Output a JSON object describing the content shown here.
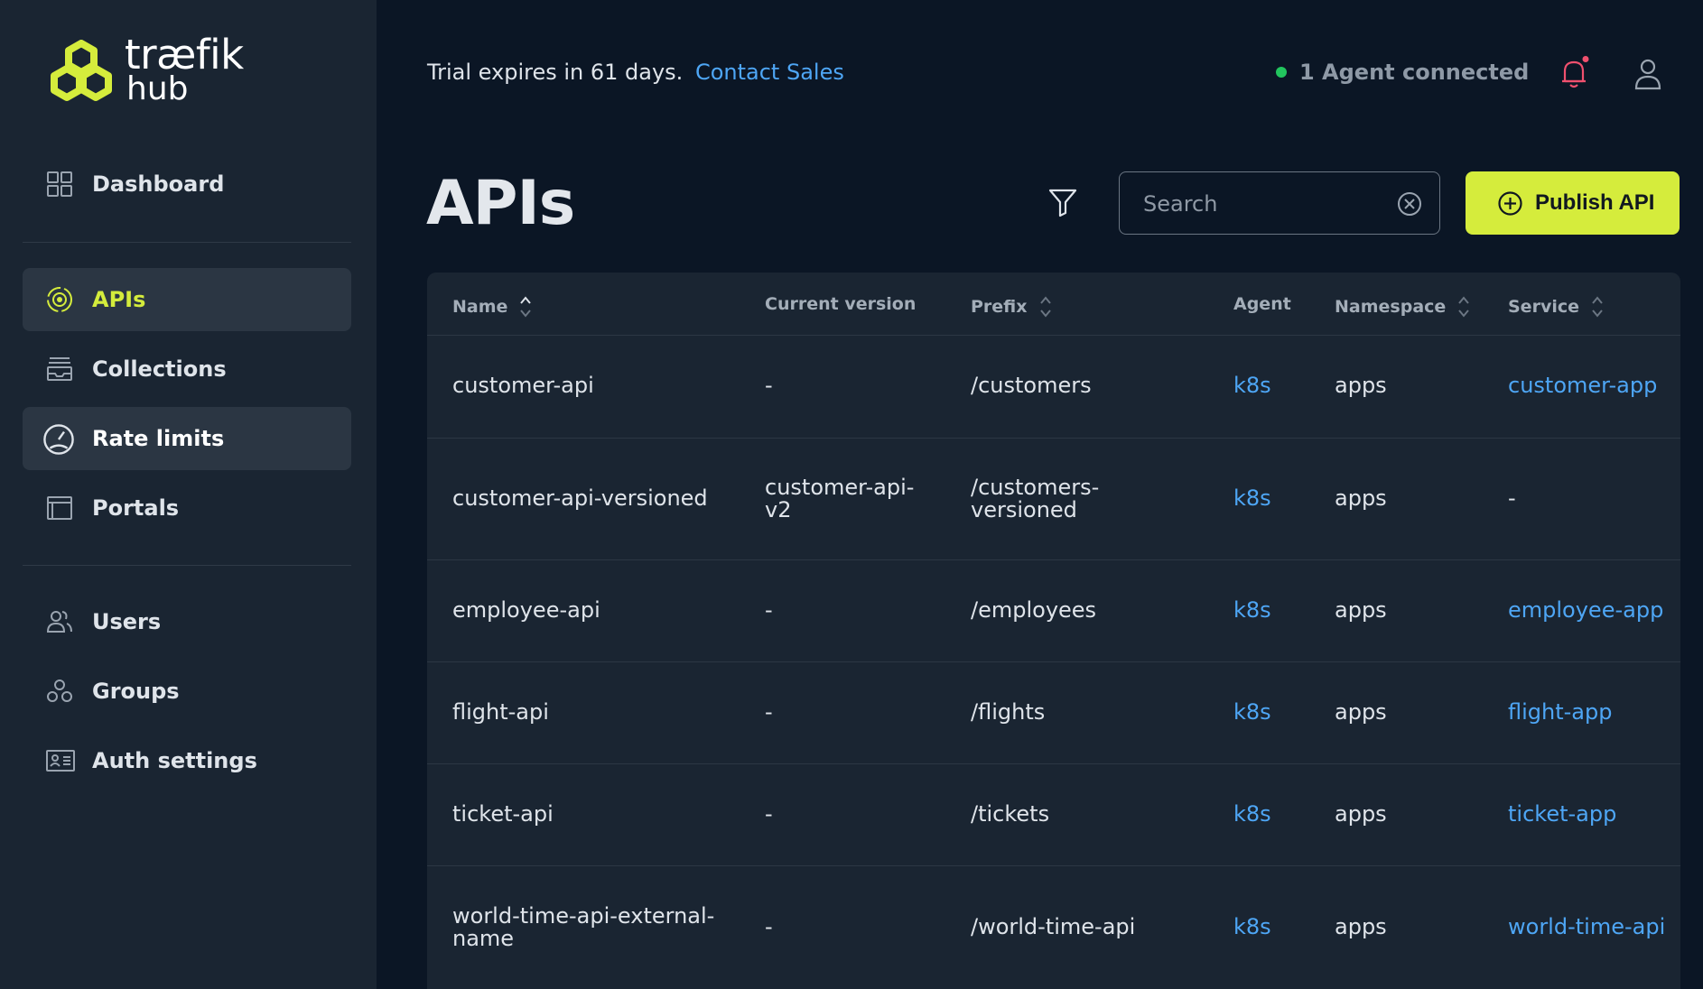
{
  "brand": {
    "word1": "træfik",
    "word2": "hub"
  },
  "sidebar": {
    "items": [
      {
        "label": "Dashboard"
      },
      {
        "label": "APIs"
      },
      {
        "label": "Collections"
      },
      {
        "label": "Rate limits"
      },
      {
        "label": "Portals"
      },
      {
        "label": "Users"
      },
      {
        "label": "Groups"
      },
      {
        "label": "Auth settings"
      }
    ]
  },
  "topbar": {
    "trial_text": "Trial expires in 61 days.",
    "contact_link": "Contact Sales",
    "agent_status": "1 Agent connected"
  },
  "page": {
    "title": "APIs",
    "search_placeholder": "Search",
    "publish_label": "Publish API"
  },
  "table": {
    "columns": [
      "Name",
      "Current version",
      "Prefix",
      "Agent",
      "Namespace",
      "Service"
    ],
    "rows": [
      {
        "name": "customer-api",
        "version": "-",
        "prefix": "/customers",
        "agent": "k8s",
        "namespace": "apps",
        "service": "customer-app"
      },
      {
        "name": "customer-api-versioned",
        "version": "customer-api-\nv2",
        "prefix": "/customers-\nversioned",
        "agent": "k8s",
        "namespace": "apps",
        "service": "-"
      },
      {
        "name": "employee-api",
        "version": "-",
        "prefix": "/employees",
        "agent": "k8s",
        "namespace": "apps",
        "service": "employee-app"
      },
      {
        "name": "flight-api",
        "version": "-",
        "prefix": "/flights",
        "agent": "k8s",
        "namespace": "apps",
        "service": "flight-app"
      },
      {
        "name": "ticket-api",
        "version": "-",
        "prefix": "/tickets",
        "agent": "k8s",
        "namespace": "apps",
        "service": "ticket-app"
      },
      {
        "name": "world-time-api-external-\nname",
        "version": "-",
        "prefix": "/world-time-api",
        "agent": "k8s",
        "namespace": "apps",
        "service": "world-time-api"
      }
    ]
  },
  "colors": {
    "accent": "#d5ec3c",
    "link": "#4ea6f5",
    "background": "#0b1625",
    "panel": "#1a2532",
    "status_ok": "#22c55e",
    "notification": "#f0506e"
  },
  "icons": {
    "dashboard": "grid-icon",
    "apis": "api-target-icon",
    "collections": "collections-icon",
    "rate_limits": "gauge-icon",
    "portals": "portal-window-icon",
    "users": "users-icon",
    "groups": "groups-icon",
    "auth": "id-card-icon"
  }
}
